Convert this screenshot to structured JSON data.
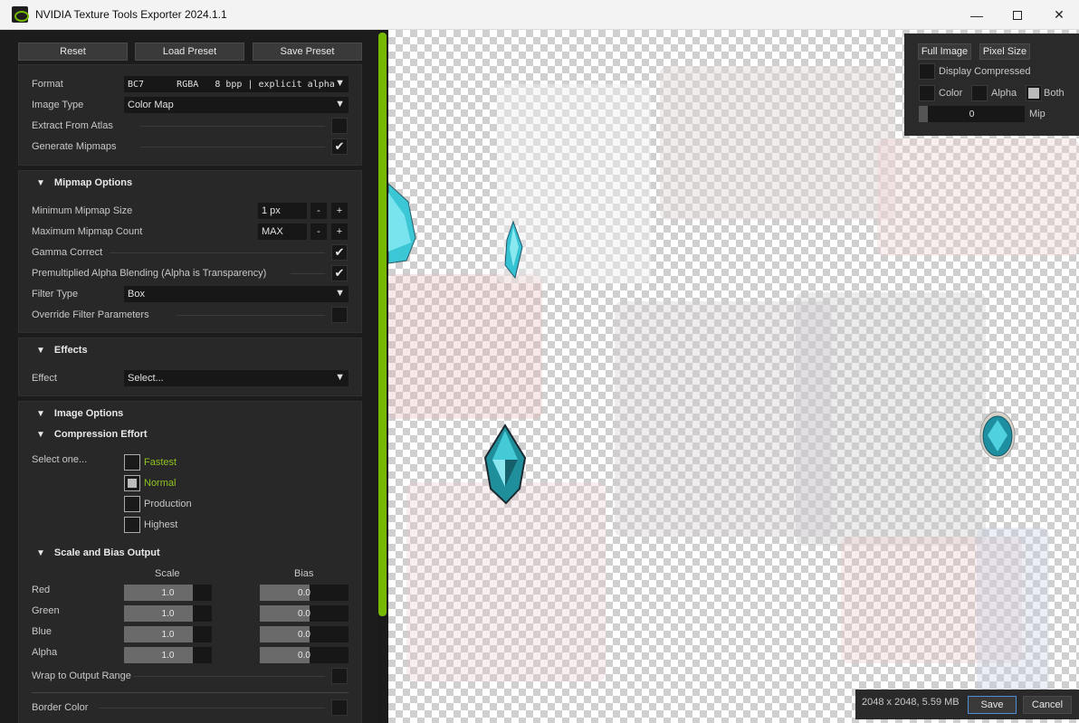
{
  "window": {
    "title": "NVIDIA Texture Tools Exporter 2024.1.1",
    "minimize": "—",
    "close": "✕"
  },
  "toolbar": {
    "reset": "Reset",
    "load_preset": "Load Preset",
    "save_preset": "Save Preset"
  },
  "format_section": {
    "format_label": "Format",
    "format_value": "BC7      RGBA   8 bpp | explicit alpha",
    "image_type_label": "Image Type",
    "image_type_value": "Color Map",
    "extract_from_atlas_label": "Extract From Atlas",
    "extract_from_atlas_checked": false,
    "generate_mipmaps_label": "Generate Mipmaps",
    "generate_mipmaps_checked": true
  },
  "mipmap": {
    "header": "Mipmap Options",
    "min_size_label": "Minimum Mipmap Size",
    "min_size_value": "1 px",
    "max_count_label": "Maximum Mipmap Count",
    "max_count_value": "MAX",
    "minus": "-",
    "plus": "+",
    "gamma_label": "Gamma Correct",
    "premult_label": "Premultiplied Alpha Blending (Alpha is Transparency)",
    "filter_type_label": "Filter Type",
    "filter_type_value": "Box",
    "override_label": "Override Filter Parameters"
  },
  "effects": {
    "header": "Effects",
    "effect_label": "Effect",
    "effect_value": "Select..."
  },
  "image_options": {
    "header": "Image Options",
    "compression_header": "Compression Effort",
    "select_one": "Select one...",
    "options": [
      "Fastest",
      "Normal",
      "Production",
      "Highest"
    ],
    "selected": "Normal",
    "accent": "#8fc31f"
  },
  "scale_bias": {
    "header": "Scale and Bias Output",
    "scale_col": "Scale",
    "bias_col": "Bias",
    "rows": [
      {
        "label": "Red",
        "scale": "1.0",
        "bias": "0.0"
      },
      {
        "label": "Green",
        "scale": "1.0",
        "bias": "0.0"
      },
      {
        "label": "Blue",
        "scale": "1.0",
        "bias": "0.0"
      },
      {
        "label": "Alpha",
        "scale": "1.0",
        "bias": "0.0"
      }
    ],
    "wrap_label": "Wrap to Output Range",
    "border_color_label": "Border Color"
  },
  "view_controls": {
    "full_image": "Full Image",
    "pixel_size": "Pixel Size",
    "display_compressed": "Display Compressed",
    "color": "Color",
    "alpha": "Alpha",
    "both": "Both",
    "mip_value": "0",
    "mip_label": "Mip"
  },
  "status": {
    "info": "2048 x 2048, 5.59 MB",
    "save": "Save",
    "cancel": "Cancel"
  },
  "colors": {
    "nvidia_green": "#76b900"
  }
}
